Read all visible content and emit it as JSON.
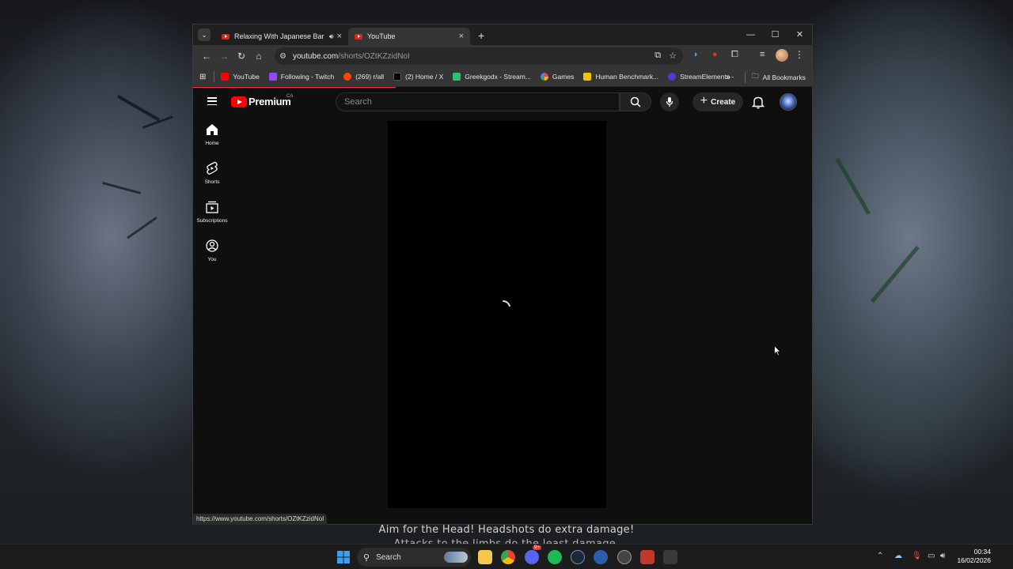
{
  "browser": {
    "tabs": [
      {
        "title": "Relaxing With Japanese Bar",
        "audio_icon": "speaker-icon",
        "active": false
      },
      {
        "title": "YouTube",
        "active": true
      }
    ],
    "url_host": "youtube.com",
    "url_path": "/shorts/OZtKZzidNoI",
    "bookmarks": [
      {
        "label": "YouTube",
        "icon": "youtube-icon",
        "color": "#ff0000"
      },
      {
        "label": "Following - Twitch",
        "icon": "twitch-icon",
        "color": "#9146ff"
      },
      {
        "label": "(269) r/all",
        "icon": "reddit-icon",
        "color": "#ff4500"
      },
      {
        "label": "(2) Home / X",
        "icon": "x-icon",
        "color": "#000000"
      },
      {
        "label": "Greekgodx - Stream...",
        "icon": "tracker-icon",
        "color": "#2fbf71"
      },
      {
        "label": "Games",
        "icon": "google-icon",
        "color": "#4285f4"
      },
      {
        "label": "Human Benchmark...",
        "icon": "lightning-icon",
        "color": "#f5c400"
      },
      {
        "label": "StreamElements -",
        "icon": "streamelements-icon",
        "color": "#4b3bd6"
      }
    ],
    "all_bookmarks_label": "All Bookmarks",
    "overflow_label": "»",
    "status_url": "https://www.youtube.com/shorts/OZtKZzidNoI"
  },
  "youtube": {
    "logo_text": "Premium",
    "region_badge": "CA",
    "search_placeholder": "Search",
    "create_label": "Create",
    "guide": [
      {
        "label": "Home",
        "icon": "home-icon"
      },
      {
        "label": "Shorts",
        "icon": "shorts-icon"
      },
      {
        "label": "Subscriptions",
        "icon": "subscriptions-icon"
      },
      {
        "label": "You",
        "icon": "you-icon"
      }
    ]
  },
  "desktop": {
    "overlay_line1": "Aim for the Head! Headshots do extra damage!",
    "overlay_line2": "Attacks to the limbs do the least damage."
  },
  "taskbar": {
    "search_label": "Search",
    "discord_badge": "9+",
    "time": "00:34",
    "date": "16/02/2026"
  },
  "colors": {
    "yt_red": "#ff0000",
    "loading_bar": "#ff2d55"
  }
}
